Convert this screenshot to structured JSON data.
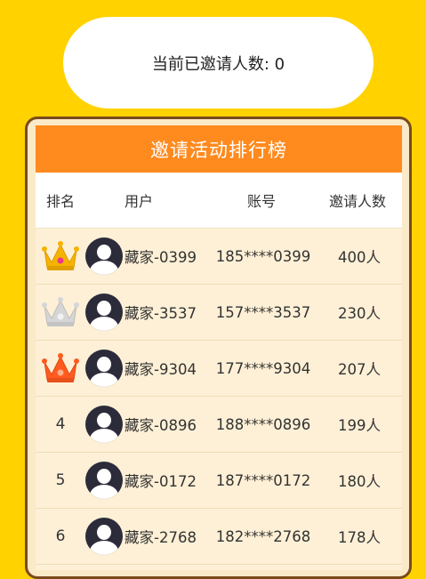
{
  "invite": {
    "label": "当前已邀请人数: 0"
  },
  "board": {
    "title": "邀请活动排行榜",
    "columns": [
      "排名",
      "用户",
      "账号",
      "邀请人数"
    ],
    "rows": [
      {
        "rank": "",
        "crown": "gold-crown-icon",
        "user": "藏家-0399",
        "account": "185****0399",
        "count": "400人"
      },
      {
        "rank": "",
        "crown": "silver-crown-icon",
        "user": "藏家-3537",
        "account": "157****3537",
        "count": "230人"
      },
      {
        "rank": "",
        "crown": "bronze-crown-icon",
        "user": "藏家-9304",
        "account": "177****9304",
        "count": "207人"
      },
      {
        "rank": "4",
        "user": "藏家-0896",
        "account": "188****0896",
        "count": "199人"
      },
      {
        "rank": "5",
        "user": "藏家-0172",
        "account": "187****0172",
        "count": "180人"
      },
      {
        "rank": "6",
        "user": "藏家-2768",
        "account": "182****2768",
        "count": "178人"
      }
    ]
  },
  "colors": {
    "background": "#FFD200",
    "header": "#FF8A1E",
    "gold": "#F5B400",
    "silver": "#C9C9C9",
    "bronze": "#FF5A1F"
  }
}
